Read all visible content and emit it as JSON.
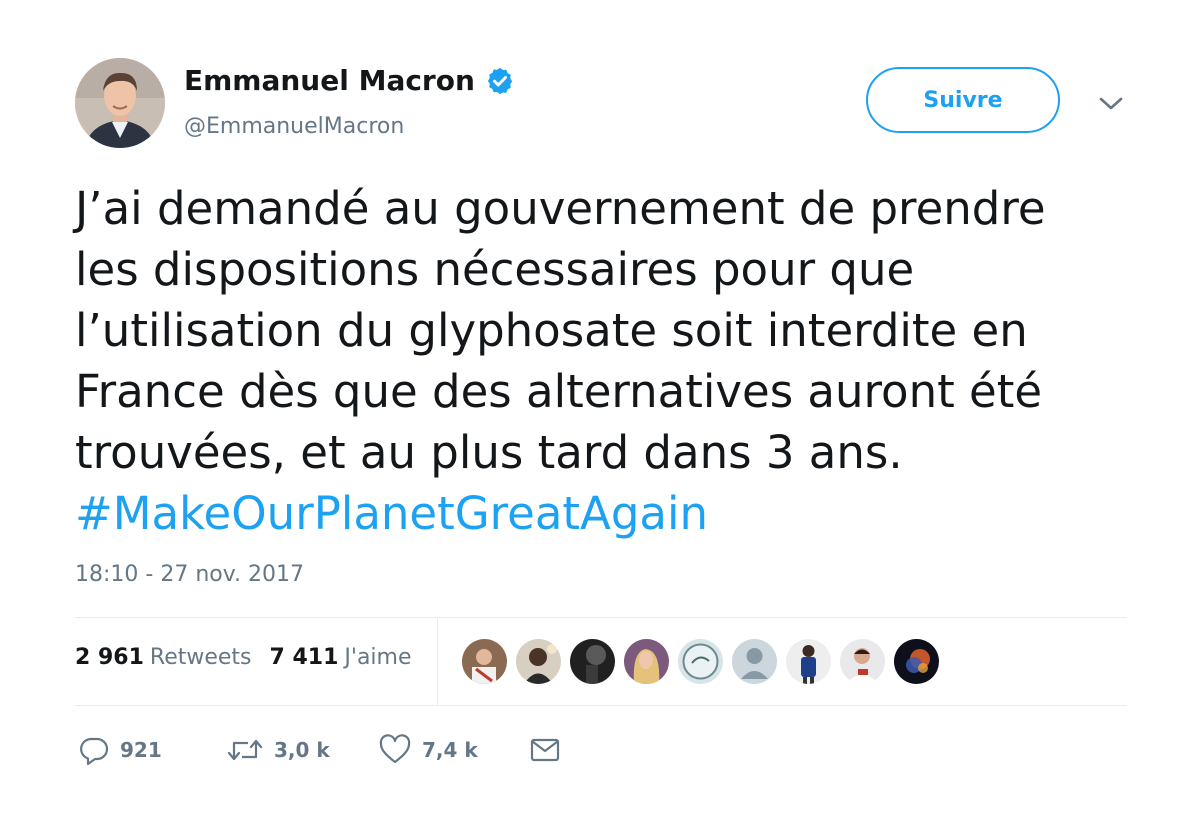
{
  "author": {
    "name": "Emmanuel Macron",
    "handle": "@EmmanuelMacron",
    "verified": true
  },
  "follow_button": {
    "label": "Suivre"
  },
  "tweet": {
    "lines": [
      "J’ai demandé au gouvernement de prendre",
      "les dispositions nécessaires pour que",
      "l’utilisation du glyphosate soit interdite en",
      "France dès que des alternatives auront été",
      "trouvées, et au plus tard dans 3 ans."
    ],
    "hashtag": "#MakeOurPlanetGreatAgain",
    "timestamp": "18:10 - 27 nov. 2017"
  },
  "stats": {
    "retweets_value": "2 961",
    "retweets_label": "Retweets",
    "likes_value": "7 411",
    "likes_label": "J'aime"
  },
  "actions": {
    "reply_count": "921",
    "retweet_count": "3,0 k",
    "like_count": "7,4 k"
  },
  "icons": {
    "verified": "verified-badge-icon",
    "caret": "chevron-down-icon",
    "reply": "reply-icon",
    "retweet": "retweet-icon",
    "like": "heart-icon",
    "message": "envelope-icon"
  },
  "colors": {
    "accent": "#1da1f2",
    "text": "#14171a",
    "muted": "#657786",
    "divider": "#e6ecf0"
  }
}
